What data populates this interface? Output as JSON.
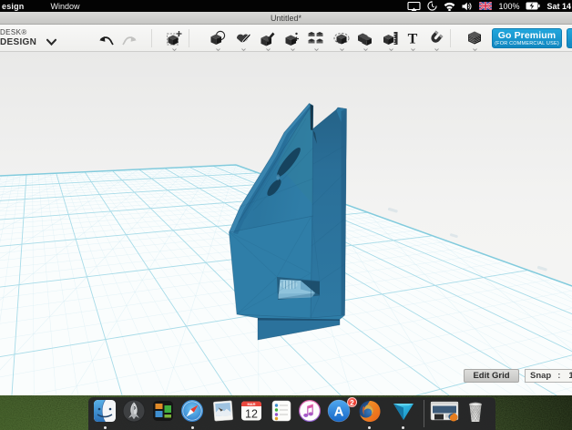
{
  "menu_bar": {
    "menus": [
      {
        "label": "esign"
      },
      {
        "label": "Window"
      }
    ],
    "status": {
      "battery_percent": "100%",
      "clock": "Sat 14"
    },
    "status_icons": [
      "airplay-display-icon",
      "time-machine-icon",
      "wifi-icon",
      "volume-icon",
      "uk-flag-icon",
      "battery-charging-icon"
    ]
  },
  "window": {
    "title": "Untitled*"
  },
  "toolbar": {
    "logo_line1": "DESK®",
    "logo_line2": "DESIGN",
    "tools": [
      {
        "icon": "transform-cube-icon"
      },
      {
        "icon": "primitives-cube-icon"
      },
      {
        "icon": "sketch-pencil-icon"
      },
      {
        "icon": "construct-brush-icon"
      },
      {
        "icon": "modify-cube-plus-icon"
      },
      {
        "icon": "pattern-grid-icon"
      },
      {
        "icon": "grouping-lasso-icon"
      },
      {
        "icon": "combine-cubes-icon"
      },
      {
        "icon": "measure-ruler-icon"
      },
      {
        "icon": "text-tool-icon"
      },
      {
        "icon": "snap-magnet-icon"
      },
      {
        "icon": "material-layers-icon"
      }
    ],
    "text_tool_glyph": "T",
    "premium": {
      "label": "Go Premium",
      "sublabel": "(FOR COMMERCIAL USE)"
    }
  },
  "viewport": {
    "edit_grid_label": "Edit Grid",
    "snap_label": "Snap",
    "snap_separator": ":",
    "snap_value": "1"
  },
  "dock": {
    "apps": [
      {
        "icon": "finder-icon",
        "running": true
      },
      {
        "icon": "launchpad-icon",
        "running": false
      },
      {
        "icon": "dashboard-tiles-icon",
        "running": false
      },
      {
        "icon": "safari-icon",
        "running": true
      },
      {
        "icon": "preview-photo-icon",
        "running": false
      },
      {
        "icon": "calendar-icon",
        "running": false
      },
      {
        "icon": "reminders-icon",
        "running": false
      },
      {
        "icon": "itunes-icon",
        "running": false
      },
      {
        "icon": "app-store-icon",
        "running": false
      },
      {
        "icon": "firefox-icon",
        "running": true
      },
      {
        "icon": "123d-design-icon",
        "running": true
      },
      {
        "icon": "minimized-window-icon",
        "running": false
      },
      {
        "icon": "trash-icon",
        "running": false
      }
    ],
    "app_store_badge": "2",
    "app_store_letter": "A",
    "calendar_day": "12",
    "calendar_month": "MAR"
  }
}
